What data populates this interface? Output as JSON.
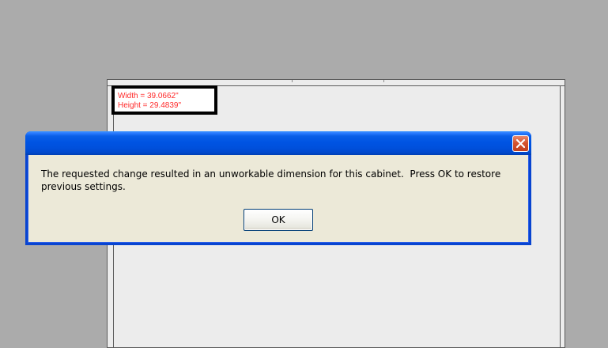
{
  "dimensions": {
    "width_text": "Width = 39.0662\"",
    "height_text": "Height = 29.4839\""
  },
  "dialog": {
    "title": "",
    "message": "The requested change resulted in an unworkable dimension for this cabinet.  Press OK to restore previous settings.",
    "ok_label": "OK",
    "close_icon": "close-icon"
  },
  "colors": {
    "background": "#ababab",
    "canvas": "#ececec",
    "dimension_text": "#ff2a2a",
    "titlebar_blue": "#0054e3",
    "dialog_face": "#ece9d8",
    "close_red": "#d5542f"
  }
}
